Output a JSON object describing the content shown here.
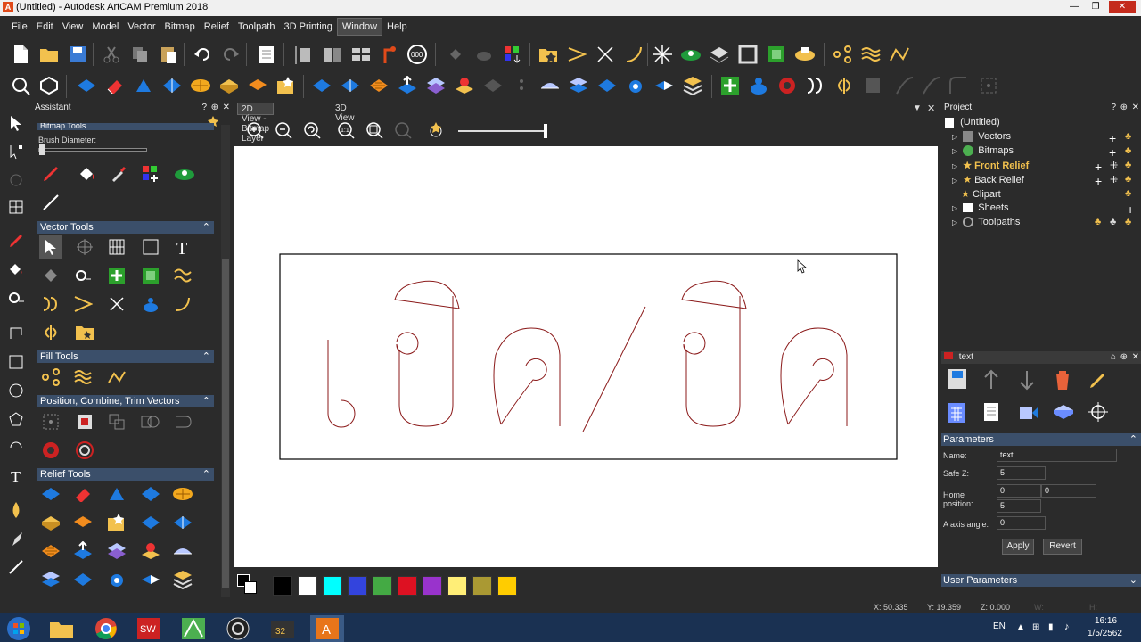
{
  "window": {
    "title": "(Untitled) - Autodesk ArtCAM Premium 2018",
    "app_icon": "A"
  },
  "menu": [
    "File",
    "Edit",
    "View",
    "Model",
    "Vector",
    "Bitmap",
    "Relief",
    "Toolpath",
    "3D Printing",
    "Window",
    "Help"
  ],
  "assistant": {
    "title": "Assistant",
    "brush_label": "Brush Diameter:",
    "bitmap_tools_label": "Bitmap Tools",
    "sections": {
      "vector_tools": "Vector Tools",
      "fill_tools": "Fill Tools",
      "position_tools": "Position, Combine, Trim Vectors",
      "relief_tools": "Relief Tools"
    }
  },
  "view": {
    "tabs": [
      "2D View - Bitmap Layer",
      "3D View"
    ]
  },
  "palette": {
    "colors": [
      "#000000",
      "#ffffff",
      "#00ffff",
      "#3344dd",
      "#44aa44",
      "#dd1122",
      "#9933cc",
      "#ffee77",
      "#aa9933",
      "#ffcc00"
    ]
  },
  "project": {
    "title": "Project",
    "root": "(Untitled)",
    "items": [
      {
        "label": "Vectors",
        "bold": false
      },
      {
        "label": "Bitmaps",
        "bold": false
      },
      {
        "label": "Front Relief",
        "bold": true
      },
      {
        "label": "Back Relief",
        "bold": false
      },
      {
        "label": "Clipart",
        "bold": false
      },
      {
        "label": "Sheets",
        "bold": false
      },
      {
        "label": "Toolpaths",
        "bold": false
      }
    ]
  },
  "text_panel": {
    "title": "text",
    "parameters_label": "Parameters",
    "name_label": "Name:",
    "name_value": "text",
    "safez_label": "Safe Z:",
    "safez_value": "5",
    "home_label_1": "Home",
    "home_label_2": "position:",
    "home_x": "0",
    "home_y": "0",
    "home_z": "5",
    "axis_label": "A axis angle:",
    "axis_value": "0",
    "apply": "Apply",
    "revert": "Revert",
    "user_params": "User Parameters"
  },
  "status": {
    "x": "X: 50.335",
    "y": "Y: 19.359",
    "z": "Z: 0.000",
    "w": "W:",
    "h": "H:"
  },
  "taskbar": {
    "lang": "EN",
    "time": "16:16",
    "date": "1/5/2562"
  }
}
